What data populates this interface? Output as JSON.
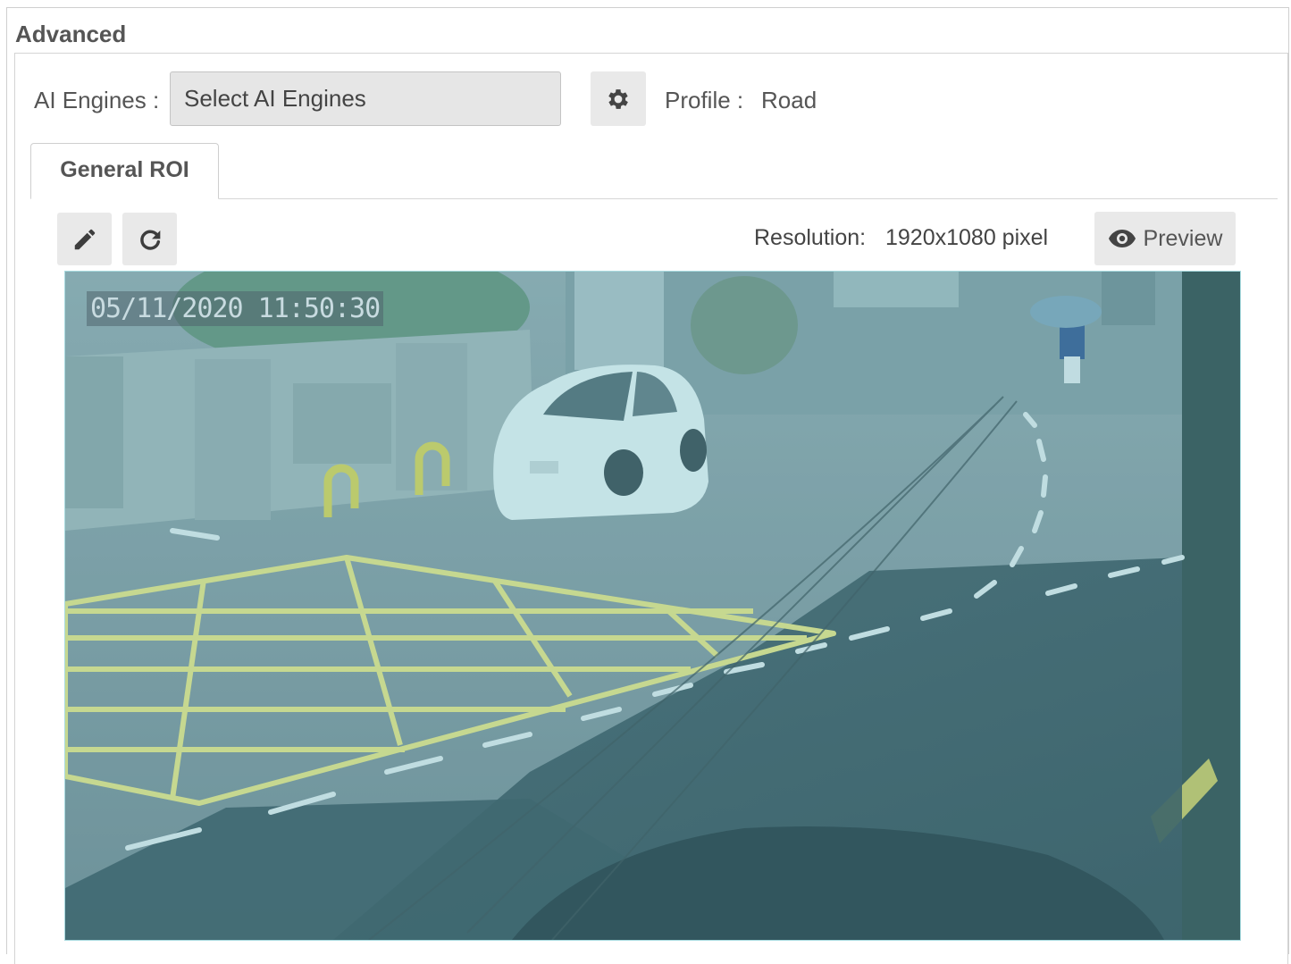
{
  "section": {
    "title": "Advanced"
  },
  "ai_engines": {
    "label": "AI Engines :",
    "select_text": "Select AI Engines"
  },
  "profile": {
    "label": "Profile :",
    "value": "Road"
  },
  "tabs": [
    {
      "label": "General ROI",
      "active": true
    }
  ],
  "toolbar": {
    "edit_icon": "pencil-icon",
    "reset_icon": "refresh-icon",
    "resolution_label": "Resolution:",
    "resolution_value": "1920x1080 pixel",
    "preview_label": "Preview",
    "preview_icon": "eye-icon"
  },
  "camera": {
    "timestamp": "05/11/2020 11:50:30"
  },
  "colors": {
    "button_bg": "#e9e9e9",
    "roi_tint": "#6ebec8",
    "road_marking": "#e8e27a"
  }
}
